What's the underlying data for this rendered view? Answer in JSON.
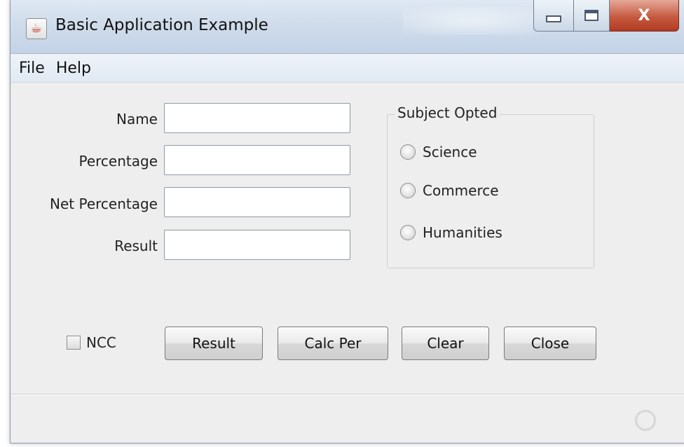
{
  "window": {
    "title": "Basic Application Example",
    "app_icon": "java-cup-icon",
    "controls": {
      "minimize": "minimize-icon",
      "maximize": "maximize-icon",
      "close_glyph": "X"
    }
  },
  "menu": {
    "items": [
      "File",
      "Help"
    ]
  },
  "form": {
    "fields": [
      {
        "label": "Name",
        "value": ""
      },
      {
        "label": "Percentage",
        "value": ""
      },
      {
        "label": "Net Percentage",
        "value": ""
      },
      {
        "label": "Result",
        "value": ""
      }
    ]
  },
  "subject_group": {
    "title": "Subject Opted",
    "options": [
      "Science",
      "Commerce",
      "Humanities"
    ],
    "selected": null
  },
  "ncc_checkbox": {
    "label": "NCC",
    "checked": false
  },
  "buttons": {
    "result": "Result",
    "calc_per": "Calc Per",
    "clear": "Clear",
    "close": "Close"
  },
  "status_bar": {
    "busy_indicator": "busy-indicator-icon"
  }
}
